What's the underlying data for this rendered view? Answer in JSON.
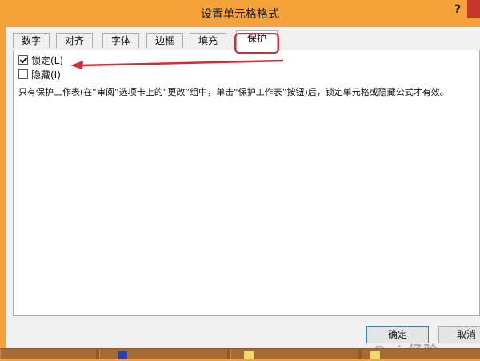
{
  "dialog": {
    "title": "设置单元格格式",
    "help_label": "?"
  },
  "tabs": [
    {
      "label": "数字",
      "active": false
    },
    {
      "label": "对齐",
      "active": false
    },
    {
      "label": "字体",
      "active": false
    },
    {
      "label": "边框",
      "active": false
    },
    {
      "label": "填充",
      "active": false
    },
    {
      "label": "保护",
      "active": true
    }
  ],
  "protection": {
    "locked_label": "锁定(L)",
    "locked_checked": true,
    "hidden_label": "隐藏(I)",
    "hidden_checked": false,
    "description": "只有保护工作表(在“审阅”选项卡上的“更改”组中，单击“保护工作表”按钮)后，锁定单元格或隐藏公式才有效。"
  },
  "footer": {
    "ok_label": "确定",
    "cancel_label": "取消"
  },
  "watermark_text": "Bai 经验",
  "colors": {
    "title_bar": "#f6a23a",
    "highlight": "#d62b35",
    "annotation_arrow": "#d62b35"
  }
}
